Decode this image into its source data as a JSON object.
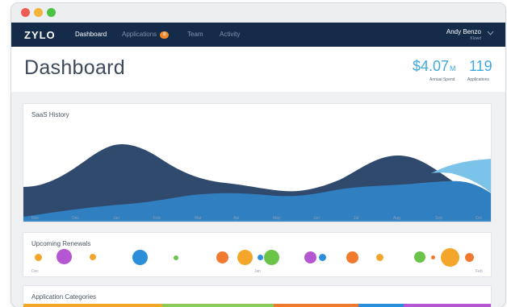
{
  "window": {
    "controls": [
      "close",
      "minimize",
      "maximize"
    ]
  },
  "nav": {
    "logo": "ZYLO",
    "items": [
      {
        "label": "Dashboard",
        "active": true
      },
      {
        "label": "Applications",
        "badge": "8"
      },
      {
        "label": "Team"
      },
      {
        "label": "Activity"
      }
    ],
    "user": {
      "name": "Andy Benzo",
      "org": "Klowd"
    }
  },
  "header": {
    "title": "Dashboard",
    "stats": [
      {
        "value": "$4.07",
        "unit": "M",
        "label": "Annual Spend"
      },
      {
        "value": "119",
        "unit": "",
        "label": "Applications"
      }
    ]
  },
  "saas_history": {
    "title": "SaaS History",
    "months": [
      "Nov",
      "Dec",
      "Jan",
      "Feb",
      "Mar",
      "Apr",
      "May",
      "Jun",
      "Jul",
      "Aug",
      "Sep",
      "Oct"
    ],
    "colors": {
      "dark": "#2f4a6d",
      "mid": "#2f7fc1",
      "light": "#7cc3ea"
    }
  },
  "renewals": {
    "title": "Upcoming Renewals",
    "date_labels": [
      "Dec",
      "Jan",
      "Feb"
    ],
    "bubbles": [
      {
        "color": "#f4a62a",
        "size": "small"
      },
      {
        "color": "#b556d3",
        "size": "large"
      },
      {
        "color": "#f4a62a",
        "size": "small"
      },
      {
        "color": "#2a8fd8",
        "size": "large"
      },
      {
        "color": "#6bc44a",
        "size": "tiny"
      },
      {
        "color": "#f27a2e",
        "size": "medium"
      },
      {
        "color": "#f4a62a",
        "size": "large"
      },
      {
        "color": "#2a8fd8",
        "size": "tiny"
      },
      {
        "color": "#6bc44a",
        "size": "large"
      },
      {
        "color": "#b556d3",
        "size": "medium"
      },
      {
        "color": "#2a8fd8",
        "size": "small"
      },
      {
        "color": "#f27a2e",
        "size": "medium"
      },
      {
        "color": "#f4a62a",
        "size": "small"
      },
      {
        "color": "#6bc44a",
        "size": "medium"
      },
      {
        "color": "#f27a2e",
        "size": "tiny"
      },
      {
        "color": "#f4a62a",
        "size": "xlarge"
      },
      {
        "color": "#f27a2e",
        "size": "small"
      }
    ]
  },
  "categories": {
    "title": "Application Categories",
    "colors": [
      "#f4a62a",
      "#8bcb5a",
      "#f27a2e",
      "#2a8fd8",
      "#b556d3"
    ]
  }
}
